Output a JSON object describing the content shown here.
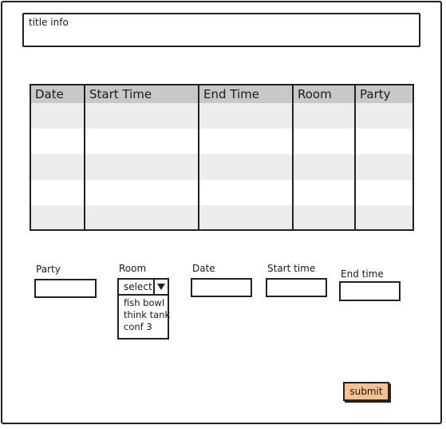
{
  "title_info": "title info",
  "table": {
    "headers": [
      "Date",
      "Start Time",
      "End Time",
      "Room",
      "Party"
    ]
  },
  "form": {
    "party_label": "Party",
    "room_label": "Room",
    "date_label": "Date",
    "start_time_label": "Start time",
    "end_time_label": "End time",
    "room_select_value": "select",
    "room_options": [
      "fish bowl",
      "think tank",
      "conf 3"
    ]
  },
  "submit_label": "submit",
  "colors": {
    "header_bg": "#c8c8c8",
    "row_alt": "#ececec",
    "submit_bg": "#f6c08f"
  }
}
